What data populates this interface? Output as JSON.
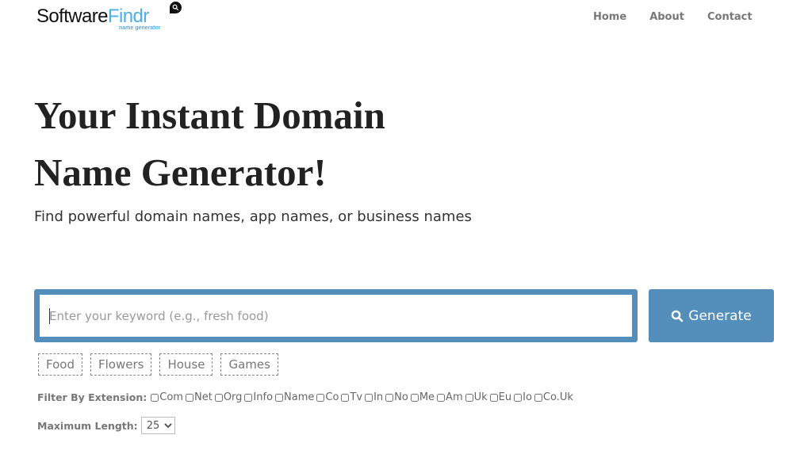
{
  "header": {
    "logo": {
      "part1": "Software",
      "part2": "Findr",
      "tagline": "name generator",
      "icon": "chat-search-bubble-icon"
    },
    "nav": [
      {
        "label": "Home"
      },
      {
        "label": "About"
      },
      {
        "label": "Contact"
      }
    ]
  },
  "hero": {
    "title_line1": "Your Instant Domain",
    "title_line2": "Name Generator!",
    "subtitle": "Find powerful domain names, app names, or business names"
  },
  "search": {
    "placeholder": "Enter your keyword (e.g., fresh food)",
    "value": "",
    "button_label": "Generate",
    "button_icon": "search-icon",
    "color": "#548ebb"
  },
  "suggestions": [
    "Food",
    "Flowers",
    "House",
    "Games"
  ],
  "filter": {
    "label": "Filter By Extension:",
    "extensions": [
      {
        "label": "Com",
        "checked": false
      },
      {
        "label": "Net",
        "checked": false
      },
      {
        "label": "Org",
        "checked": false
      },
      {
        "label": "Info",
        "checked": false
      },
      {
        "label": "Name",
        "checked": false
      },
      {
        "label": "Co",
        "checked": false
      },
      {
        "label": "Tv",
        "checked": false
      },
      {
        "label": "In",
        "checked": false
      },
      {
        "label": "No",
        "checked": false
      },
      {
        "label": "Me",
        "checked": false
      },
      {
        "label": "Am",
        "checked": false
      },
      {
        "label": "Uk",
        "checked": false
      },
      {
        "label": "Eu",
        "checked": false
      },
      {
        "label": "Io",
        "checked": false
      },
      {
        "label": "Co.Uk",
        "checked": false
      }
    ]
  },
  "max_length": {
    "label": "Maximum Length:",
    "selected": "25"
  }
}
